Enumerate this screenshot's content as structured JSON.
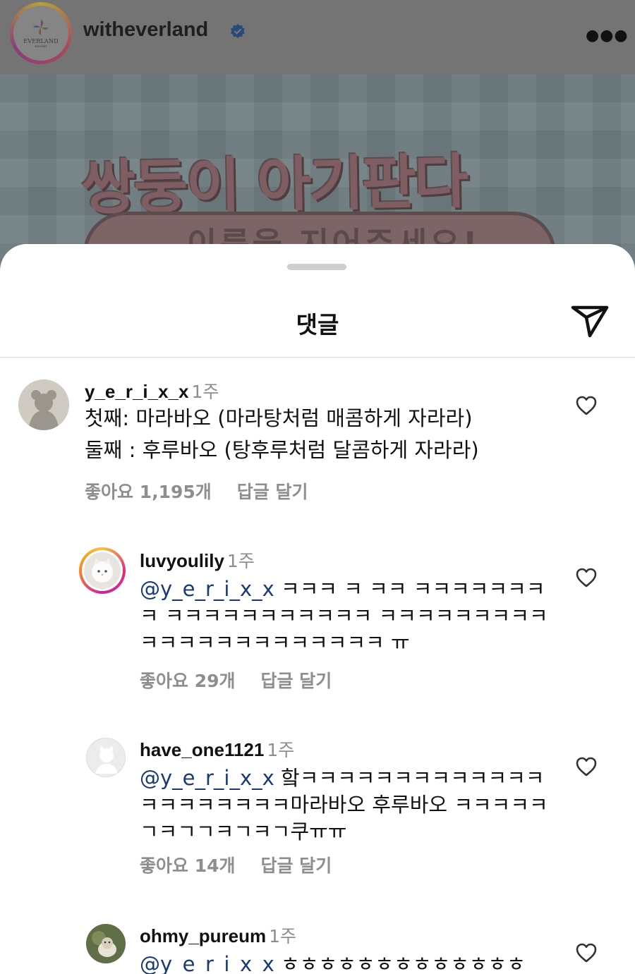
{
  "post": {
    "username": "witheverland",
    "avatar_logo_text": "EVERLAND",
    "avatar_logo_subtext": "RESORT",
    "image_title": "쌍둥이 아기판다",
    "image_banner_text": "이름을 지어주세요!",
    "icons": {
      "verified": "verified-badge-icon",
      "more": "more-options-icon"
    }
  },
  "sheet": {
    "title": "댓글",
    "share_icon": "send-icon"
  },
  "comments": [
    {
      "username": "y_e_r_i_x_x",
      "time": "1주",
      "lines": [
        {
          "text": "첫째: 마라바오 (마라탕처럼 매콤하게 자라라)"
        },
        {
          "text": "둘째 : 후루바오 (탕후루처럼 달콤하게 자라라)"
        }
      ],
      "likes": "좋아요 1,195개",
      "reply": "답글 달기"
    },
    {
      "username": "luvyoulily",
      "time": "1주",
      "mention": "@y_e_r_i_x_x",
      "lines": [
        {
          "text": " ㅋㅋㅋ ㅋ ㅋㅋ ㅋㅋㅋㅋㅋㅋㅋ"
        },
        {
          "text": "ㅋ ㅋㅋㅋㅋㅋㅋㅋㅋㅋㅋㅋ ㅋㅋㅋㅋㅋㅋㅋㅋㅋ"
        },
        {
          "text": "ㅋㅋㅋㅋㅋㅋㅋㅋㅋㅋㅋㅋㅋ ㅠ"
        }
      ],
      "likes": "좋아요 29개",
      "reply": "답글 달기"
    },
    {
      "username": "have_one1121",
      "time": "1주",
      "mention": "@y_e_r_i_x_x",
      "lines": [
        {
          "text": " 핰ㅋㅋㅋㅋㅋㅋㅋㅋㅋㅋㅋㅋㅋ"
        },
        {
          "text": "ㅋㅋㅋㅋㅋㅋㅋㅋ마라바오 후루바오 ㅋㅋㅋㅋㅋ"
        },
        {
          "text": "ㄱㅋㄱㄱㅋㄱㅋㄱ쿠ㅠㅠ"
        }
      ],
      "likes": "좋아요 14개",
      "reply": "답글 달기"
    },
    {
      "username": "ohmy_pureum",
      "time": "1주",
      "mention": "@y_e_r_i_x_x",
      "lines": [
        {
          "text": " ㅎㅎㅎㅎㅎㅎㅎㅎㅎㅎㅎㅎㅎ"
        }
      ]
    }
  ],
  "icons": {
    "like": "heart-icon"
  }
}
